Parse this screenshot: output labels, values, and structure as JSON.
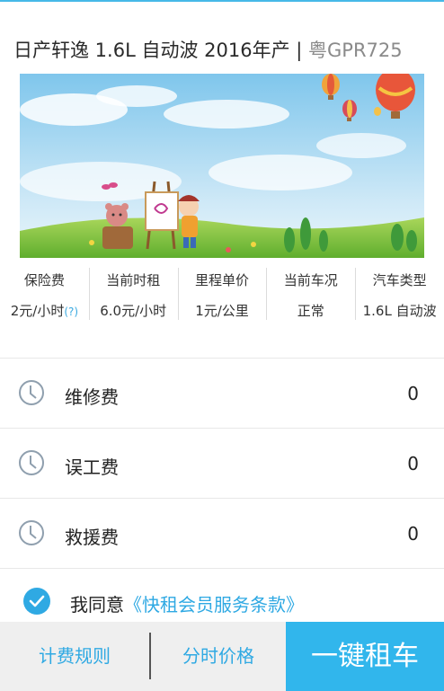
{
  "header": {
    "car_name": "日产轩逸 1.6L 自动波 2016年产",
    "separator": "|",
    "plate": "粤GPR725"
  },
  "specs": [
    {
      "label": "保险费",
      "value": "2元/小时",
      "help": "(?)"
    },
    {
      "label": "当前时租",
      "value": "6.0元/小时"
    },
    {
      "label": "里程单价",
      "value": "1元/公里"
    },
    {
      "label": "当前车况",
      "value": "正常"
    },
    {
      "label": "汽车类型",
      "value": "1.6L 自动波"
    }
  ],
  "fees": [
    {
      "label": "维修费",
      "value": "0",
      "icon": "clock-icon"
    },
    {
      "label": "误工费",
      "value": "0",
      "icon": "clock-icon"
    },
    {
      "label": "救援费",
      "value": "0",
      "icon": "clock-icon"
    }
  ],
  "agreement": {
    "prefix": "我同意",
    "link": "《快租会员服务条款》",
    "checked": true
  },
  "bottom_bar": {
    "rules_label": "计费规则",
    "pricing_label": "分时价格",
    "rent_label": "一键租车"
  },
  "colors": {
    "accent": "#31b6ec",
    "link": "#2fa9e3"
  }
}
